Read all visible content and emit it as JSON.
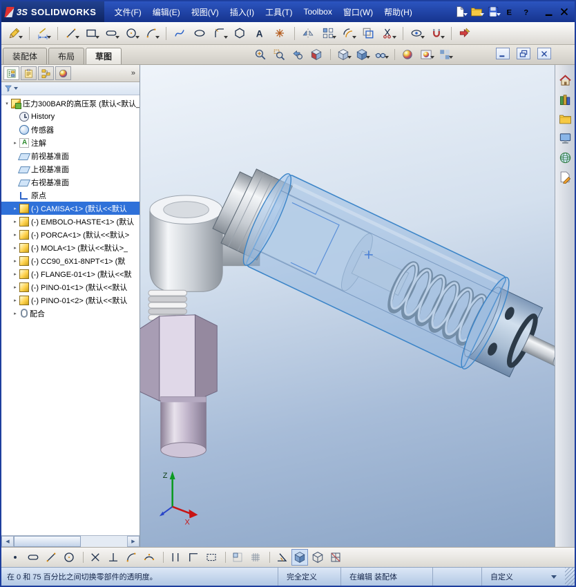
{
  "colors": {
    "titlebar": "#1e3f9e",
    "selection": "#2f71d9",
    "viewport_top": "#eff4fa",
    "viewport_bottom": "#8aa4c6",
    "glass_part": "#8fb4dd",
    "highlight_edge": "#3c85c8"
  },
  "titlebar": {
    "logo_mark": "3S",
    "logo_text": "SOLIDWORKS",
    "menus": [
      {
        "name": "menu-file",
        "label": "文件(F)"
      },
      {
        "name": "menu-edit",
        "label": "编辑(E)"
      },
      {
        "name": "menu-view",
        "label": "视图(V)"
      },
      {
        "name": "menu-insert",
        "label": "插入(I)"
      },
      {
        "name": "menu-tools",
        "label": "工具(T)"
      },
      {
        "name": "menu-toolbox",
        "label": "Toolbox"
      },
      {
        "name": "menu-window",
        "label": "窗口(W)"
      },
      {
        "name": "menu-help",
        "label": "帮助(H)"
      }
    ],
    "buttons": [
      {
        "name": "new-document-button",
        "icon": "#s-doc",
        "cls": "has-caret"
      },
      {
        "name": "open-button",
        "icon": "#s-folderw",
        "cls": "has-caret"
      },
      {
        "name": "save-button",
        "icon": "#s-floppy",
        "cls": "has-caret"
      },
      {
        "name": "email-button",
        "icon": "#s-E"
      },
      {
        "name": "help-button",
        "icon": "#s-help"
      }
    ],
    "window_buttons": [
      {
        "name": "minimize-window-button",
        "icon": "#s-min"
      },
      {
        "name": "close-window-button",
        "icon": "#s-close"
      }
    ]
  },
  "toolbar2": {
    "icons": [
      {
        "name": "sketch-button",
        "icon": "#s-pencil",
        "cls": "has-caret"
      },
      {
        "name": "smart-dimension-button",
        "icon": "#s-dim",
        "cls": "has-caret gap"
      },
      {
        "name": "line-tool-button",
        "icon": "#s-linetool",
        "cls": "has-caret gap"
      },
      {
        "name": "corner-rectangle-button",
        "icon": "#s-rect",
        "cls": "has-caret"
      },
      {
        "name": "straight-slot-button",
        "icon": "#s-slot",
        "cls": "has-caret"
      },
      {
        "name": "circle-tool-button",
        "icon": "#s-circletool",
        "cls": "has-caret"
      },
      {
        "name": "centerpoint-arc-button",
        "icon": "#s-arc",
        "cls": "has-caret"
      },
      {
        "name": "spline-button",
        "icon": "#s-spline",
        "cls": "gap"
      },
      {
        "name": "ellipse-button",
        "icon": "#s-ellipsetool"
      },
      {
        "name": "sketch-fillet-button",
        "icon": "#s-fillet",
        "cls": "has-caret"
      },
      {
        "name": "polygon-button",
        "icon": "#s-polygon"
      },
      {
        "name": "text-button",
        "icon": "#s-text"
      },
      {
        "name": "point-button",
        "icon": "#s-point"
      },
      {
        "name": "mirror-entities-button",
        "icon": "#s-mirror",
        "cls": "gap"
      },
      {
        "name": "linear-pattern-button",
        "icon": "#s-pattern",
        "cls": "has-caret"
      },
      {
        "name": "offset-entities-button",
        "icon": "#s-offset",
        "cls": "has-caret"
      },
      {
        "name": "convert-entities-button",
        "icon": "#s-convert"
      },
      {
        "name": "trim-entities-button",
        "icon": "#s-trim",
        "cls": "has-caret"
      },
      {
        "name": "display-relations-button",
        "icon": "#s-relations",
        "cls": "has-caret gap"
      },
      {
        "name": "quick-snaps-button",
        "icon": "#s-snaps",
        "cls": "has-caret"
      },
      {
        "name": "exit-sketch-button",
        "icon": "#s-exitsketch",
        "cls": "gap"
      }
    ]
  },
  "tabstrip": {
    "tabs": [
      {
        "name": "tab-assembly",
        "label": "装配体",
        "cls": ""
      },
      {
        "name": "tab-layout",
        "label": "布局",
        "cls": ""
      },
      {
        "name": "tab-sketch",
        "label": "草图",
        "cls": "active"
      }
    ],
    "hud": [
      {
        "name": "zoom-to-fit-button",
        "icon": "#s-zoomfit"
      },
      {
        "name": "zoom-to-area-button",
        "icon": "#s-zoomarea"
      },
      {
        "name": "previous-view-button",
        "icon": "#s-prevview"
      },
      {
        "name": "section-view-button",
        "icon": "#s-section"
      },
      {
        "name": "view-orientation-button",
        "icon": "#s-cube",
        "cls": "has-caret gap"
      },
      {
        "name": "display-style-button",
        "icon": "#s-shadedcube",
        "cls": "has-caret"
      },
      {
        "name": "hide-show-items-button",
        "icon": "#s-glasses",
        "cls": "has-caret"
      },
      {
        "name": "edit-appearance-button",
        "icon": "#s-ball",
        "cls": "gap"
      },
      {
        "name": "apply-scene-button",
        "icon": "#s-scene",
        "cls": "has-caret"
      },
      {
        "name": "view-settings-button",
        "icon": "#s-viewsettings",
        "cls": "has-caret"
      }
    ],
    "doc_controls": [
      {
        "name": "doc-minimize-button",
        "icon": "#s-docmin"
      },
      {
        "name": "doc-restore-button",
        "icon": "#s-docrestore"
      },
      {
        "name": "doc-close-button",
        "icon": "#s-close"
      }
    ]
  },
  "left_panel": {
    "tabs": [
      {
        "name": "featuremanager-tab",
        "icon": "#s-fmtree",
        "cls": "active"
      },
      {
        "name": "propertymanager-tab",
        "icon": "#s-clipboard"
      },
      {
        "name": "configurationmanager-tab",
        "icon": "#s-config"
      },
      {
        "name": "displaymanager-tab",
        "icon": "#s-ball"
      }
    ],
    "chevrons": "»",
    "scroll": {
      "left": "◀",
      "right": "▶"
    },
    "tree": [
      {
        "icon_class": "ico-asm",
        "twist": "▾",
        "label": "压力300BAR的高压泵 (默认<默认_",
        "row_class": "root"
      },
      {
        "icon_class": "ico-history",
        "twist": "",
        "label": "History",
        "row_class": "lvl1"
      },
      {
        "icon_class": "ico-sensor",
        "twist": "",
        "label": "传感器",
        "row_class": "lvl1"
      },
      {
        "icon_class": "ico-ann",
        "twist": "▸",
        "label": "注解",
        "row_class": "lvl1"
      },
      {
        "icon_class": "ico-plane",
        "twist": "",
        "label": "前视基准面",
        "row_class": "lvl1"
      },
      {
        "icon_class": "ico-plane",
        "twist": "",
        "label": "上视基准面",
        "row_class": "lvl1"
      },
      {
        "icon_class": "ico-plane",
        "twist": "",
        "label": "右视基准面",
        "row_class": "lvl1"
      },
      {
        "icon_class": "ico-origin",
        "twist": "",
        "label": "原点",
        "row_class": "lvl1"
      },
      {
        "icon_class": "ico-part",
        "twist": "▸",
        "label": "(-) CAMISA<1> (默认<<默认",
        "row_class": "lvl1 sel"
      },
      {
        "icon_class": "ico-part",
        "twist": "▸",
        "label": "(-) EMBOLO-HASTE<1> (默认",
        "row_class": "lvl1"
      },
      {
        "icon_class": "ico-part",
        "twist": "▸",
        "label": "(-) PORCA<1> (默认<<默认>",
        "row_class": "lvl1"
      },
      {
        "icon_class": "ico-part",
        "twist": "▸",
        "label": "(-) MOLA<1> (默认<<默认>_",
        "row_class": "lvl1"
      },
      {
        "icon_class": "ico-part",
        "twist": "▸",
        "label": "(-) CC90_6X1-8NPT<1> (默",
        "row_class": "lvl1"
      },
      {
        "icon_class": "ico-part",
        "twist": "▸",
        "label": "(-) FLANGE-01<1> (默认<<默",
        "row_class": "lvl1"
      },
      {
        "icon_class": "ico-part",
        "twist": "▸",
        "label": "(-) PINO-01<1> (默认<<默认",
        "row_class": "lvl1"
      },
      {
        "icon_class": "ico-part",
        "twist": "▸",
        "label": "(-) PINO-01<2> (默认<<默认",
        "row_class": "lvl1"
      },
      {
        "icon_class": "ico-mates",
        "twist": "▸",
        "label": "配合",
        "row_class": "lvl1"
      }
    ]
  },
  "viewport": {
    "triad": {
      "x": "X",
      "z": "Z"
    }
  },
  "right_strip": {
    "icons": [
      {
        "name": "solidworks-resources-tab",
        "icon": "#s-house"
      },
      {
        "name": "design-library-tab",
        "icon": "#s-books"
      },
      {
        "name": "file-explorer-tab",
        "icon": "#s-folderw"
      },
      {
        "name": "view-palette-tab",
        "icon": "#s-monitor"
      },
      {
        "name": "appearances-scenes-tab",
        "icon": "#s-globe"
      },
      {
        "name": "custom-properties-tab",
        "icon": "#s-sheetpencil"
      }
    ]
  },
  "bottom_toolbar": {
    "icons": [
      {
        "name": "point-tool-button",
        "icon": "#s-pointsm"
      },
      {
        "name": "slot-tool-button",
        "icon": "#s-slot"
      },
      {
        "name": "line-tool-button",
        "icon": "#s-linetool"
      },
      {
        "name": "circle-tool-button",
        "icon": "#s-circletool"
      },
      {
        "name": "intersection-tool-button",
        "icon": "#s-xmark",
        "cls": "gap"
      },
      {
        "name": "perpendicular-tool-button",
        "icon": "#s-perp"
      },
      {
        "name": "tangent-arc-tool-button",
        "icon": "#s-arc"
      },
      {
        "name": "three-point-arc-tool-button",
        "icon": "#s-arc2"
      },
      {
        "name": "parallel-tool-button",
        "icon": "#s-parallel",
        "cls": "gap"
      },
      {
        "name": "corner-tool-button",
        "icon": "#s-corner"
      },
      {
        "name": "dashed-rectangle-tool-button",
        "icon": "#s-dashrect"
      },
      {
        "name": "grid-cell-tool-button",
        "icon": "#s-gridcell",
        "cls": "gap"
      },
      {
        "name": "grid-display-button",
        "icon": "#s-gridsm"
      },
      {
        "name": "angle-snap-button",
        "icon": "#s-angle",
        "cls": "gap"
      },
      {
        "name": "shaded-view-button",
        "icon": "#s-shadedcube",
        "cls": "pressed"
      },
      {
        "name": "wireframe-view-button",
        "icon": "#s-cubewire"
      },
      {
        "name": "section-grid-button",
        "icon": "#s-sectiongrid"
      }
    ]
  },
  "statusbar": {
    "hint": "在 0 和 75 百分比之间切换零部件的透明度。",
    "definition_status": "完全定义",
    "edit_status": "在编辑 装配体",
    "units_label": "自定义"
  }
}
